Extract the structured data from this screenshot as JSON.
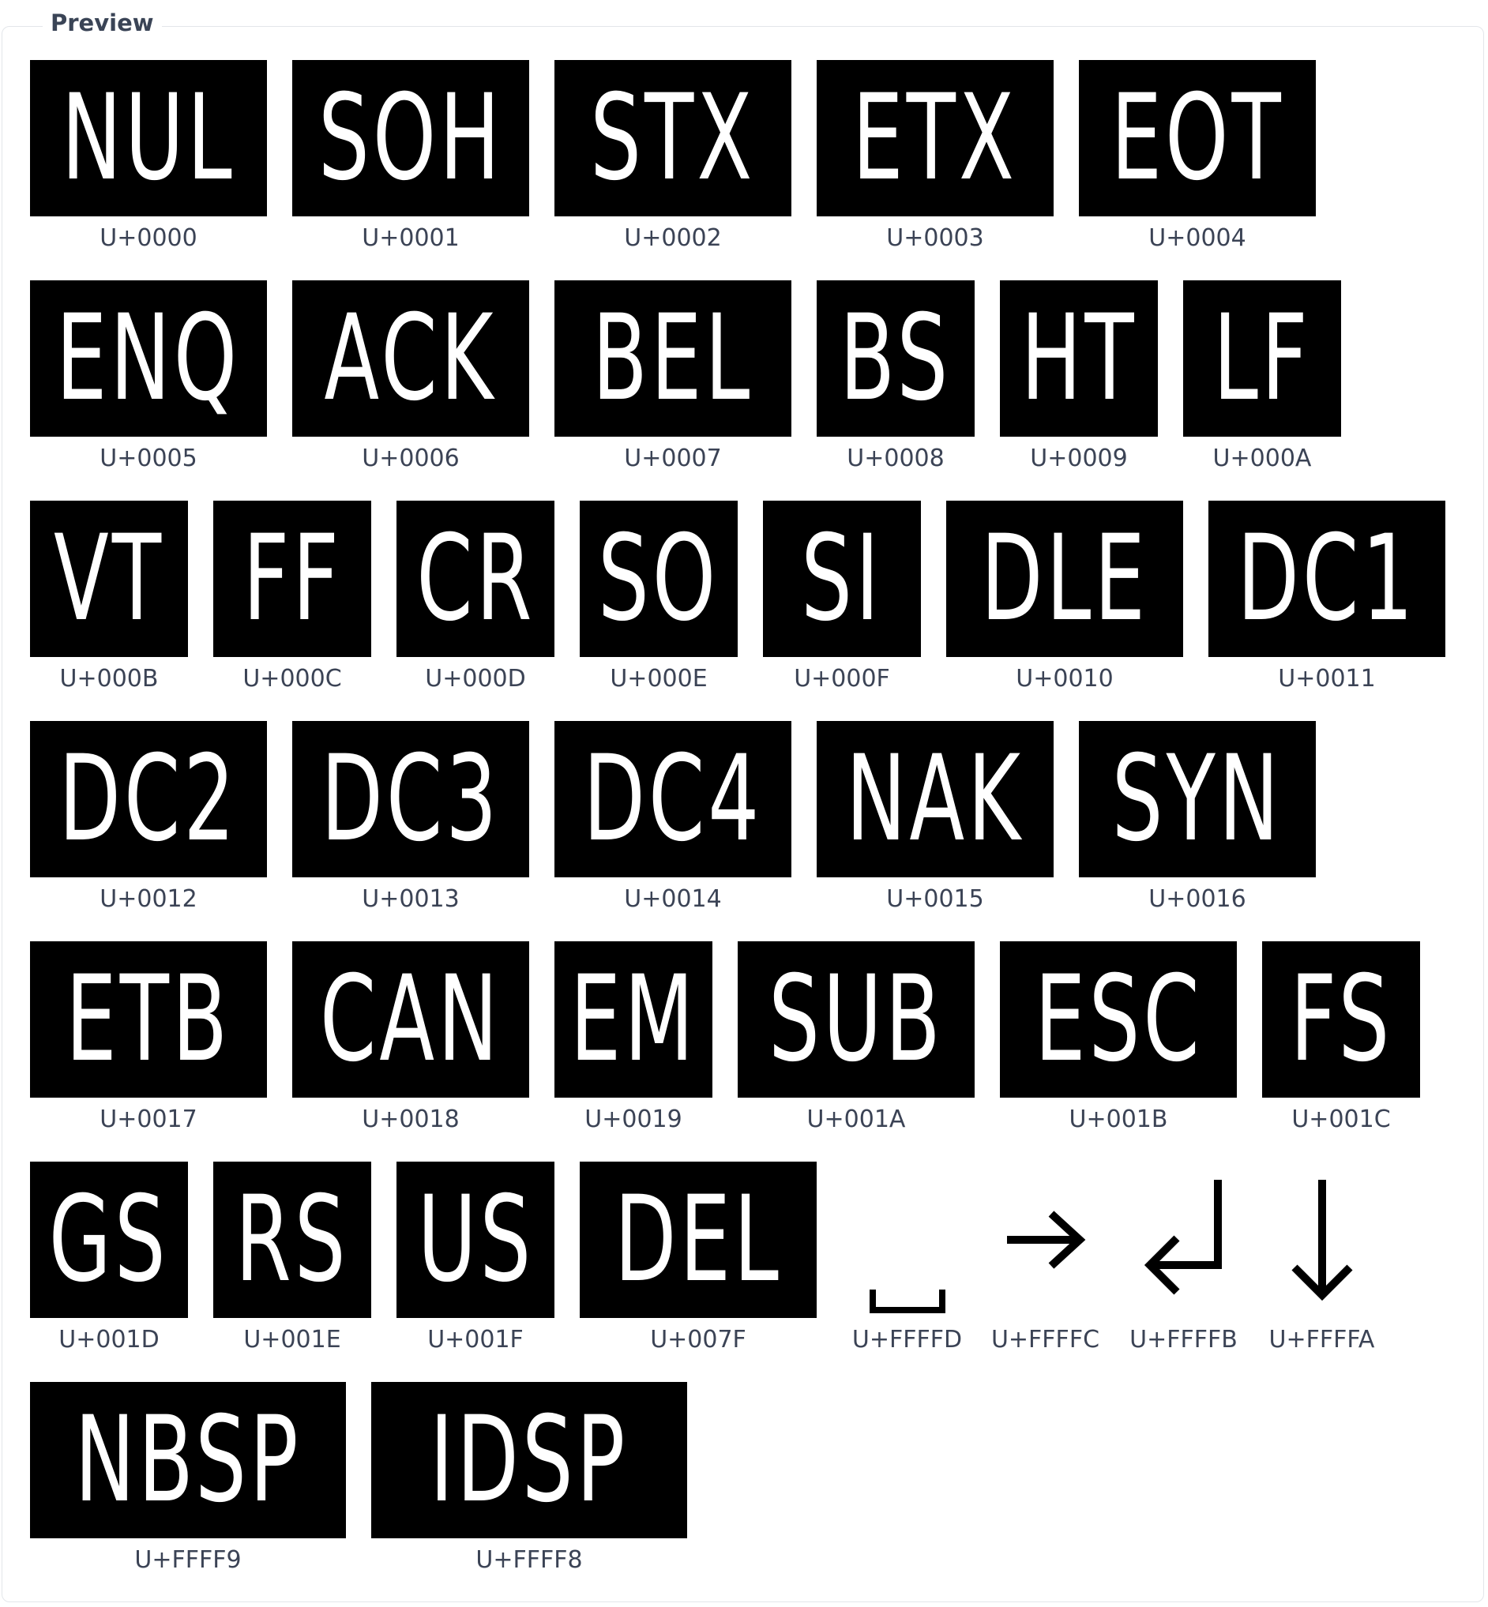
{
  "panel": {
    "legend": "Preview"
  },
  "rows": [
    [
      {
        "label": "NUL",
        "code": "U+0000"
      },
      {
        "label": "SOH",
        "code": "U+0001"
      },
      {
        "label": "STX",
        "code": "U+0002"
      },
      {
        "label": "ETX",
        "code": "U+0003"
      },
      {
        "label": "EOT",
        "code": "U+0004"
      }
    ],
    [
      {
        "label": "ENQ",
        "code": "U+0005"
      },
      {
        "label": "ACK",
        "code": "U+0006"
      },
      {
        "label": "BEL",
        "code": "U+0007"
      },
      {
        "label": "BS",
        "code": "U+0008"
      },
      {
        "label": "HT",
        "code": "U+0009"
      },
      {
        "label": "LF",
        "code": "U+000A"
      }
    ],
    [
      {
        "label": "VT",
        "code": "U+000B"
      },
      {
        "label": "FF",
        "code": "U+000C"
      },
      {
        "label": "CR",
        "code": "U+000D"
      },
      {
        "label": "SO",
        "code": "U+000E"
      },
      {
        "label": "SI",
        "code": "U+000F"
      },
      {
        "label": "DLE",
        "code": "U+0010"
      },
      {
        "label": "DC1",
        "code": "U+0011"
      }
    ],
    [
      {
        "label": "DC2",
        "code": "U+0012"
      },
      {
        "label": "DC3",
        "code": "U+0013"
      },
      {
        "label": "DC4",
        "code": "U+0014"
      },
      {
        "label": "NAK",
        "code": "U+0015"
      },
      {
        "label": "SYN",
        "code": "U+0016"
      }
    ],
    [
      {
        "label": "ETB",
        "code": "U+0017"
      },
      {
        "label": "CAN",
        "code": "U+0018"
      },
      {
        "label": "EM",
        "code": "U+0019"
      },
      {
        "label": "SUB",
        "code": "U+001A"
      },
      {
        "label": "ESC",
        "code": "U+001B"
      },
      {
        "label": "FS",
        "code": "U+001C"
      }
    ],
    [
      {
        "label": "GS",
        "code": "U+001D"
      },
      {
        "label": "RS",
        "code": "U+001E"
      },
      {
        "label": "US",
        "code": "U+001F"
      },
      {
        "label": "DEL",
        "code": "U+007F"
      },
      {
        "icon": "open-box-space-icon",
        "code": "U+FFFFD"
      },
      {
        "icon": "right-arrow-icon",
        "code": "U+FFFFC"
      },
      {
        "icon": "return-arrow-icon",
        "code": "U+FFFFB"
      },
      {
        "icon": "down-arrow-icon",
        "code": "U+FFFFA"
      }
    ],
    [
      {
        "label": "NBSP",
        "code": "U+FFFF9"
      },
      {
        "label": "IDSP",
        "code": "U+FFFF8"
      }
    ]
  ]
}
